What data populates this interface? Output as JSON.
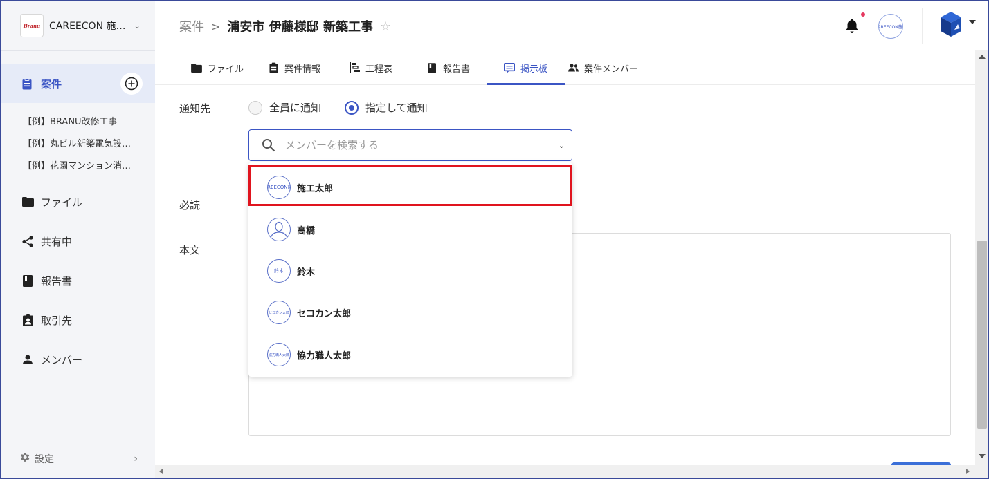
{
  "sidebar": {
    "brand_logo_text": "Branu",
    "brand_name": "CAREECON 施…",
    "active_nav": "案件",
    "projects": [
      "【例】BRANU改修工事",
      "【例】丸ビル新築電気設…",
      "【例】花園マンション消…"
    ],
    "nav": [
      "ファイル",
      "共有中",
      "報告書",
      "取引先",
      "メンバー"
    ],
    "settings": "設定"
  },
  "header": {
    "crumb_parent": "案件",
    "crumb_separator": ">",
    "crumb_current": "浦安市 伊藤様邸 新築工事",
    "avatar_text": "CAREECON施工"
  },
  "tabs": [
    "ファイル",
    "案件情報",
    "工程表",
    "報告書",
    "掲示板",
    "案件メンバー"
  ],
  "active_tab": "掲示板",
  "form": {
    "notify_label": "通知先",
    "radio_all": "全員に通知",
    "radio_specific": "指定して通知",
    "search_placeholder": "メンバーを検索する",
    "required_label": "必読",
    "body_label": "本文"
  },
  "members": [
    {
      "name": "施工太郎",
      "avatar": "CAREECON施工",
      "highlighted": true
    },
    {
      "name": "高橋",
      "avatar": "person-icon",
      "highlighted": false
    },
    {
      "name": "鈴木",
      "avatar": "鈴木",
      "highlighted": false
    },
    {
      "name": "セコカン太郎",
      "avatar": "セコカン太郎",
      "highlighted": false
    },
    {
      "name": "協力職人太郎",
      "avatar": "協力職人太郎",
      "highlighted": false
    }
  ],
  "colors": {
    "accent": "#3b55c4",
    "highlight": "#e0141e",
    "notification_dot": "#e53960"
  }
}
